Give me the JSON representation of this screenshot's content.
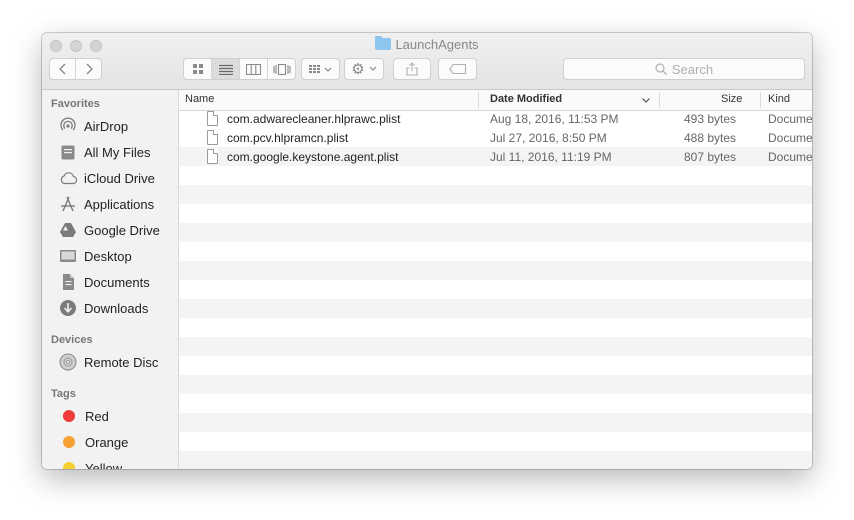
{
  "window": {
    "title": "LaunchAgents"
  },
  "toolbar": {
    "back_icon": "chevron-left-icon",
    "forward_icon": "chevron-right-icon",
    "view_modes": [
      "icon-view-icon",
      "list-view-icon",
      "column-view-icon",
      "cover-flow-icon"
    ],
    "active_view": "list",
    "search_placeholder": "Search"
  },
  "sidebar": {
    "favorites_heading": "Favorites",
    "favorites": [
      {
        "label": "AirDrop",
        "icon": "airdrop-icon"
      },
      {
        "label": "All My Files",
        "icon": "all-files-icon"
      },
      {
        "label": "iCloud Drive",
        "icon": "cloud-icon"
      },
      {
        "label": "Applications",
        "icon": "applications-icon"
      },
      {
        "label": "Google Drive",
        "icon": "google-drive-icon"
      },
      {
        "label": "Desktop",
        "icon": "desktop-icon"
      },
      {
        "label": "Documents",
        "icon": "documents-icon"
      },
      {
        "label": "Downloads",
        "icon": "downloads-icon"
      }
    ],
    "devices_heading": "Devices",
    "devices": [
      {
        "label": "Remote Disc",
        "icon": "disc-icon"
      }
    ],
    "tags_heading": "Tags",
    "tags": [
      {
        "label": "Red",
        "color": "#f03c3c"
      },
      {
        "label": "Orange",
        "color": "#f7a034"
      },
      {
        "label": "Yellow",
        "color": "#f5cf2f"
      }
    ]
  },
  "columns": {
    "name": "Name",
    "date_modified": "Date Modified",
    "size": "Size",
    "kind": "Kind"
  },
  "files": [
    {
      "name": "com.adwarecleaner.hlprawc.plist",
      "date": "Aug 18, 2016, 11:53 PM",
      "size": "493 bytes",
      "kind": "Docume"
    },
    {
      "name": "com.pcv.hlpramcn.plist",
      "date": "Jul 27, 2016, 8:50 PM",
      "size": "488 bytes",
      "kind": "Docume"
    },
    {
      "name": "com.google.keystone.agent.plist",
      "date": "Jul 11, 2016, 11:19 PM",
      "size": "807 bytes",
      "kind": "Docume"
    }
  ]
}
